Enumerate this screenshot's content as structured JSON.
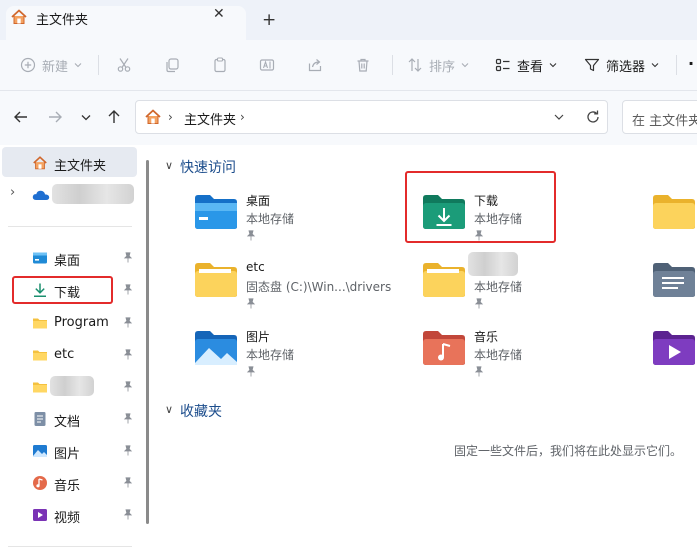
{
  "tab": {
    "title": "主文件夹",
    "close": "✕",
    "new_tab": "+"
  },
  "toolbar": {
    "new_label": "新建",
    "sort_label": "排序",
    "view_label": "查看",
    "filter_label": "筛选器",
    "more_label": "·"
  },
  "address": {
    "path": "主文件夹",
    "search_placeholder": "在 主文件夹"
  },
  "sidebar": {
    "home": "主文件夹",
    "items": [
      {
        "label": "桌面"
      },
      {
        "label": "下载"
      },
      {
        "label": "Program"
      },
      {
        "label": "etc"
      },
      {
        "label": ""
      },
      {
        "label": "文档"
      },
      {
        "label": "图片"
      },
      {
        "label": "音乐"
      },
      {
        "label": "视频"
      }
    ]
  },
  "quick_access": {
    "title": "快速访问",
    "tiles": [
      {
        "name": "桌面",
        "sub": "本地存储"
      },
      {
        "name": "下载",
        "sub": "本地存储"
      },
      {
        "name": "etc",
        "sub": "固态盘 (C:)\\Win...\\drivers"
      },
      {
        "name": "",
        "sub": "本地存储"
      },
      {
        "name": "图片",
        "sub": "本地存储"
      },
      {
        "name": "音乐",
        "sub": "本地存储"
      }
    ]
  },
  "favorites": {
    "title": "收藏夹",
    "empty_text": "固定一些文件后，我们将在此处显示它们。"
  },
  "colors": {
    "accent": "#1c4d8c",
    "highlight": "#e32b2b",
    "download_green": "#1b8f6f"
  }
}
